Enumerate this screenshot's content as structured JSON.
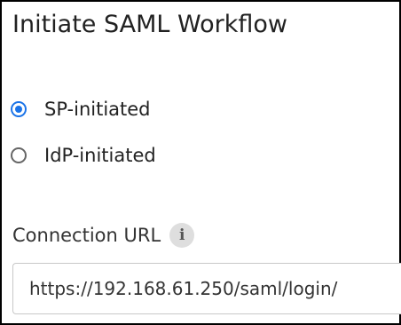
{
  "title": "Initiate SAML Workflow",
  "workflow_options": [
    {
      "label": "SP-initiated",
      "selected": true
    },
    {
      "label": "IdP-initiated",
      "selected": false
    }
  ],
  "connection_url": {
    "label": "Connection URL",
    "info_icon_glyph": "i",
    "value": "https://192.168.61.250/saml/login/"
  },
  "colors": {
    "accent": "#1a73e8",
    "text": "#222222",
    "border": "#c8c8c8"
  }
}
